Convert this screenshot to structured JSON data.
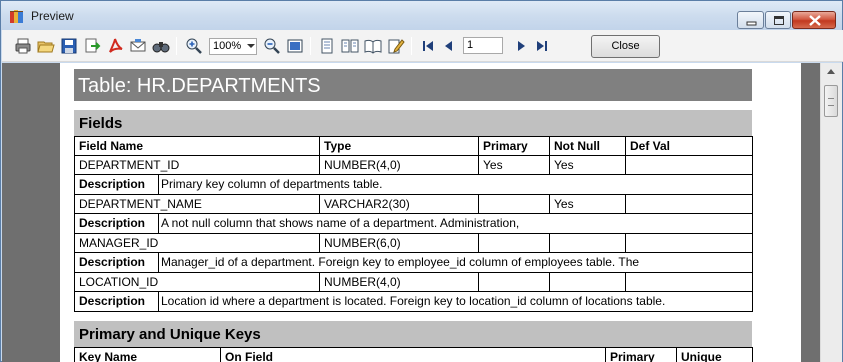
{
  "window": {
    "title": "Preview"
  },
  "toolbar": {
    "zoom_value": "100%",
    "page_value": "1",
    "close_label": "Close"
  },
  "report": {
    "table_title": "Table: HR.DEPARTMENTS",
    "fields_section": "Fields",
    "fields_headers": [
      "Field Name",
      "Type",
      "Primary",
      "Not Null",
      "Def Val"
    ],
    "description_label": "Description",
    "fields": [
      {
        "name": "DEPARTMENT_ID",
        "type": "NUMBER(4,0)",
        "primary": "Yes",
        "not_null": "Yes",
        "def_val": "",
        "description": "Primary key column of departments table."
      },
      {
        "name": "DEPARTMENT_NAME",
        "type": "VARCHAR2(30)",
        "primary": "",
        "not_null": "Yes",
        "def_val": "",
        "description": "A not null column that shows name of a department. Administration,"
      },
      {
        "name": "MANAGER_ID",
        "type": "NUMBER(6,0)",
        "primary": "",
        "not_null": "",
        "def_val": "",
        "description": "Manager_id of a department. Foreign key to employee_id column of employees table. The"
      },
      {
        "name": "LOCATION_ID",
        "type": "NUMBER(4,0)",
        "primary": "",
        "not_null": "",
        "def_val": "",
        "description": "Location id where a department is located. Foreign key to location_id column of locations table."
      }
    ],
    "keys_section": "Primary and Unique Keys",
    "keys_headers": [
      "Key Name",
      "On Field",
      "Primary",
      "Unique"
    ]
  }
}
